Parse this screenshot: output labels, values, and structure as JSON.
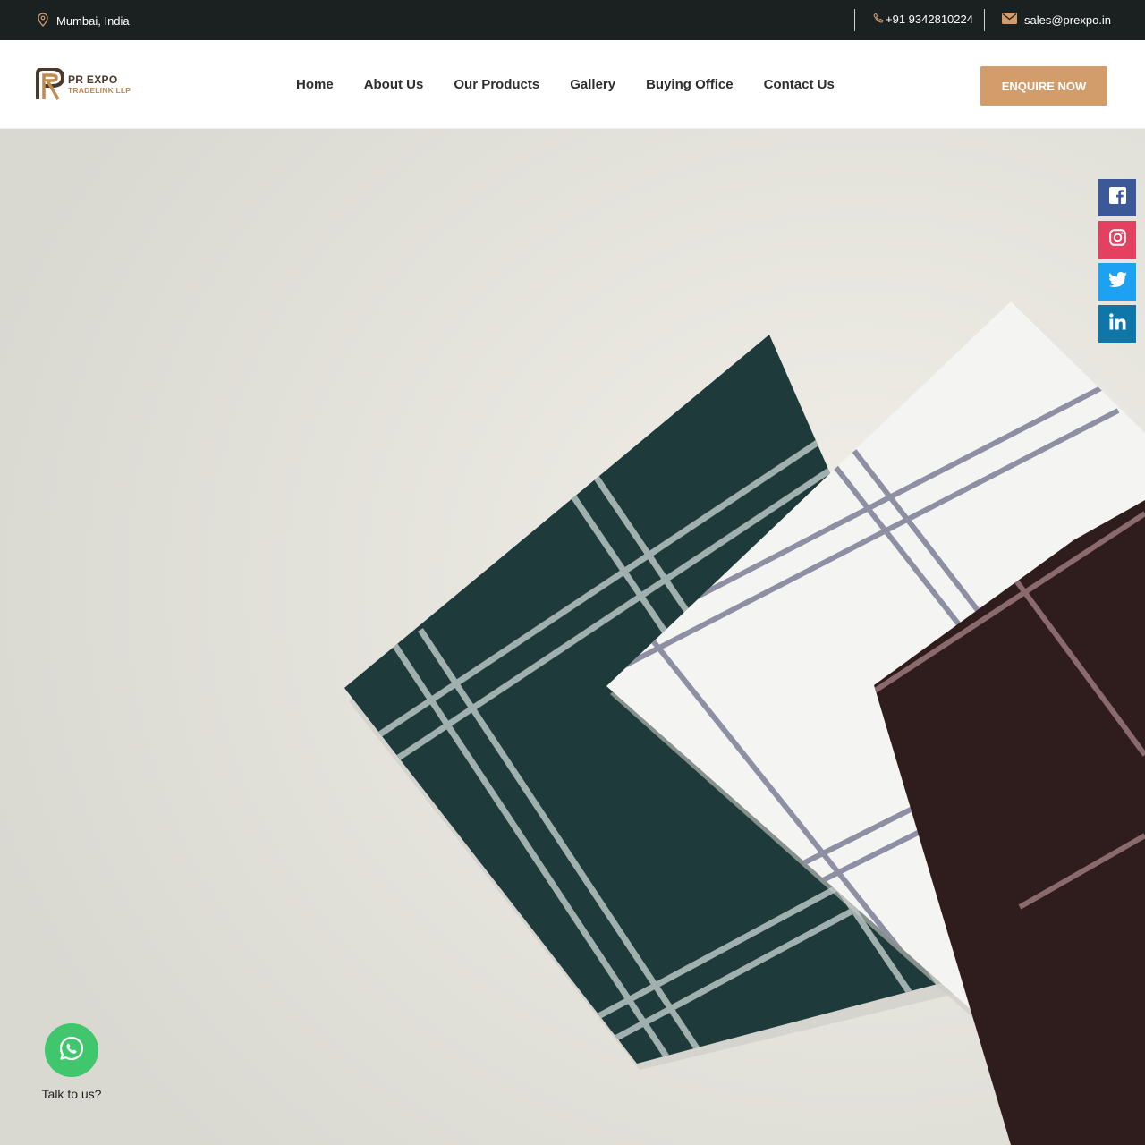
{
  "topbar": {
    "location": "Mumbai, India",
    "phone": "+91 9342810224",
    "email": "sales@prexpo.in",
    "location_icon": "map-pin-icon",
    "phone_icon": "phone-icon",
    "email_icon": "envelope-icon"
  },
  "header": {
    "logo": {
      "line1": "PR EXPO",
      "line2": "TRADELINK LLP"
    },
    "nav": [
      {
        "label": "Home"
      },
      {
        "label": "About Us"
      },
      {
        "label": "Our Products"
      },
      {
        "label": "Gallery"
      },
      {
        "label": "Buying Office"
      },
      {
        "label": "Contact Us"
      }
    ],
    "cta": "ENQUIRE NOW"
  },
  "social": [
    {
      "icon": "facebook-icon",
      "color": "#3b5998"
    },
    {
      "icon": "instagram-icon",
      "color": "#e4405f"
    },
    {
      "icon": "twitter-icon",
      "color": "#1da1f2"
    },
    {
      "icon": "linkedin-icon",
      "color": "#0e76a8"
    }
  ],
  "whatsapp": {
    "label": "Talk to us?",
    "icon": "whatsapp-icon",
    "color": "#40c66c"
  },
  "colors": {
    "topbar_bg": "#1b2021",
    "accent": "#d39c6b"
  }
}
